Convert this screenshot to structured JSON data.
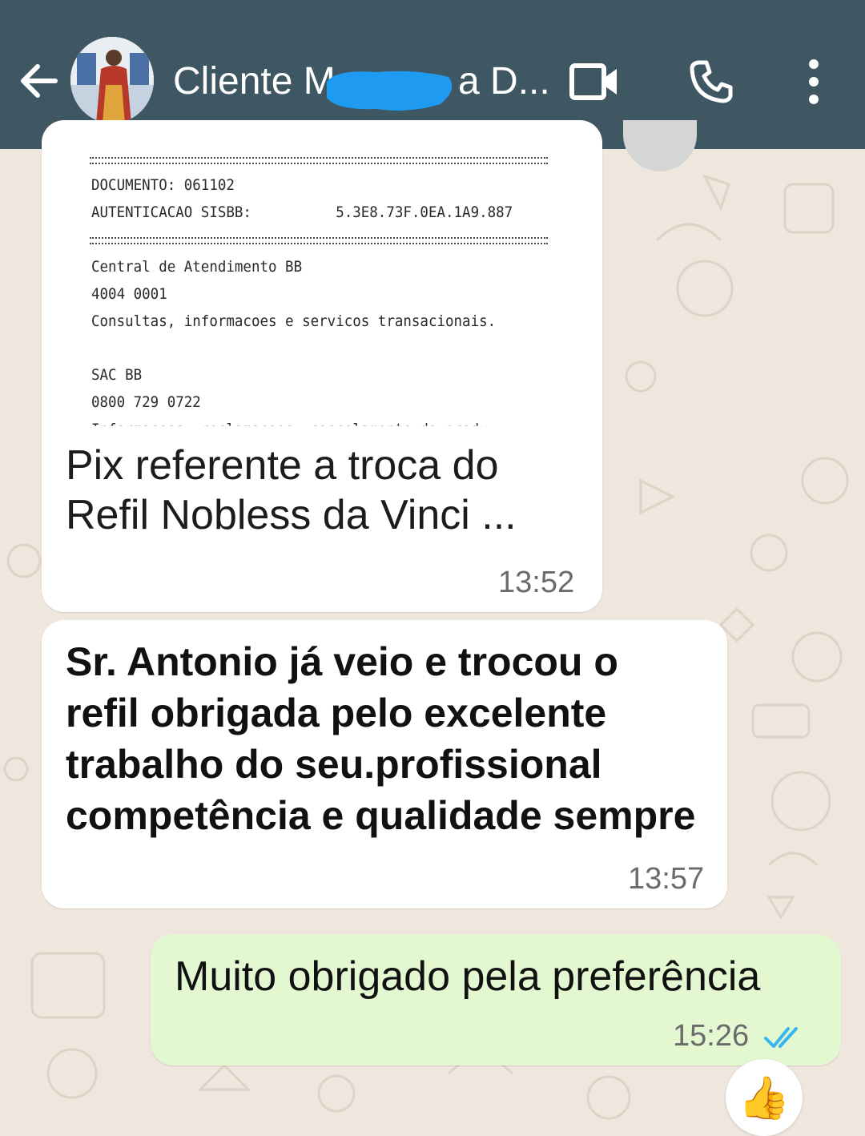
{
  "header": {
    "contact_name": "Cliente M",
    "contact_name_tail": "a D...",
    "colors": {
      "bar": "#3f5663",
      "redaction": "#1e9af0"
    }
  },
  "icons": {
    "back": "arrow-left-icon",
    "video": "video-camera-icon",
    "call": "phone-icon",
    "menu": "more-vertical-icon"
  },
  "messages": {
    "image_message": {
      "receipt_lines": [
        "DOCUMENTO: 061102",
        "AUTENTICACAO SISBB:          5.3E8.73F.0EA.1A9.887",
        "Central de Atendimento BB",
        "4004 0001",
        "Consultas, informacoes e servicos transacionais.",
        "SAC BB",
        "0800 729 0722",
        "Informacoes, reclamacoes, cancelamento de produ"
      ],
      "caption_line1": "Pix referente a troca do",
      "caption_line2": "Refil Nobless da Vinci ...",
      "time": "13:52"
    },
    "text_message": {
      "text": "Sr. Antonio já veio e trocou o refil obrigada pelo excelente trabalho do seu.profissional competência e qualidade sempre",
      "time": "13:57"
    },
    "outgoing_message": {
      "text": "Muito obrigado pela preferência",
      "time": "15:26",
      "status": "read",
      "tick_color": "#34b7f1"
    },
    "reaction": {
      "emoji": "👍"
    }
  }
}
